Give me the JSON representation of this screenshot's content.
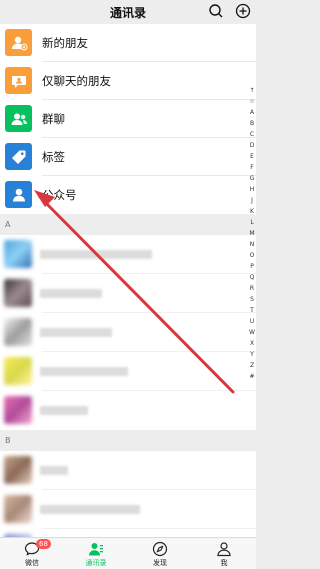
{
  "header": {
    "title": "通讯录",
    "icons": [
      "search-icon",
      "add-icon"
    ]
  },
  "functions": [
    {
      "label": "新的朋友",
      "icon": "add-friend-icon",
      "color": "#fa9d3b"
    },
    {
      "label": "仅聊天的朋友",
      "icon": "chat-only-icon",
      "color": "#fa9d3b"
    },
    {
      "label": "群聊",
      "icon": "group-chat-icon",
      "color": "#07c160"
    },
    {
      "label": "标签",
      "icon": "tag-icon",
      "color": "#2782d7"
    },
    {
      "label": "公众号",
      "icon": "official-account-icon",
      "color": "#2782d7"
    }
  ],
  "sections": [
    {
      "letter": "A",
      "contact_count": 5
    },
    {
      "letter": "B",
      "contact_count": 3
    }
  ],
  "index_letters": [
    "↑",
    "☆",
    "A",
    "B",
    "C",
    "D",
    "E",
    "F",
    "G",
    "H",
    "J",
    "K",
    "L",
    "M",
    "N",
    "O",
    "P",
    "Q",
    "R",
    "S",
    "T",
    "U",
    "W",
    "X",
    "Y",
    "Z",
    "#"
  ],
  "tabs": [
    {
      "label": "微信",
      "icon": "chat-bubble-icon",
      "badge": "68",
      "active": false
    },
    {
      "label": "通讯录",
      "icon": "contacts-icon",
      "active": true
    },
    {
      "label": "发现",
      "icon": "compass-icon",
      "active": false
    },
    {
      "label": "我",
      "icon": "person-icon",
      "active": false
    }
  ],
  "colors": {
    "accent": "#07c160",
    "badge": "#fa5151",
    "annotation_arrow": "#d9363e"
  }
}
